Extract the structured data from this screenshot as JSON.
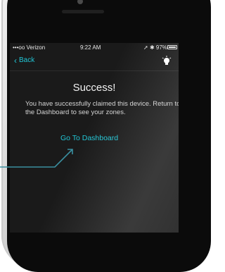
{
  "statusbar": {
    "carrier": "•••oo Verizon",
    "time": "9:22 AM",
    "battery": "97%"
  },
  "nav": {
    "back_label": "Back"
  },
  "content": {
    "title": "Success!",
    "message": "You have successfully claimed this device. Return to the Dashboard to see your zones.",
    "button": "Go To Dashboard"
  },
  "colors": {
    "accent": "#21c6d6",
    "background": "#1a1a1a"
  },
  "icons": [
    "wifi-icon",
    "location-icon",
    "bluetooth-icon",
    "battery-icon",
    "back-chevron-icon",
    "lightbulb-icon",
    "annotation-arrow-icon"
  ]
}
